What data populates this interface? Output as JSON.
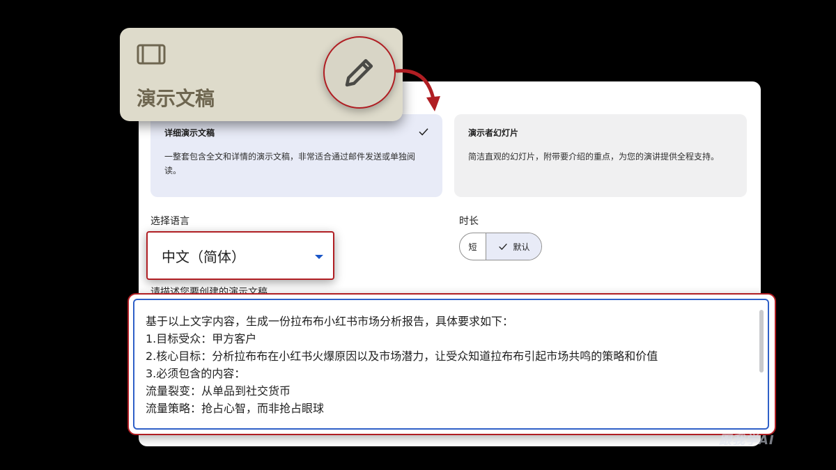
{
  "tile": {
    "icon": "slides-icon",
    "title": "演示文稿",
    "edit_icon": "pencil-icon"
  },
  "cards": [
    {
      "title": "详细演示文稿",
      "description": "一整套包含全文和详情的演示文稿，非常适合通过邮件发送或单独阅读。",
      "selected": true
    },
    {
      "title": "演示者幻灯片",
      "description": "简洁直观的幻灯片，附带要介绍的重点，为您的演讲提供全程支持。",
      "selected": false
    }
  ],
  "language": {
    "label": "选择语言",
    "value": "中文（简体）"
  },
  "duration": {
    "label": "时长",
    "options": [
      "短",
      "默认"
    ],
    "selected": "默认"
  },
  "prompt": {
    "label": "请描述您要创建的演示文稿",
    "lines": [
      "基于以上文字内容，生成一份拉布布小红书市场分析报告，具体要求如下：",
      "1.目标受众：甲方客户",
      "2.核心目标：分析拉布布在小红书火爆原因以及市场潜力，让受众知道拉布布引起市场共鸣的策略和价值",
      "3.必须包含的内容：",
      "流量裂变：从单品到社交货币",
      "流量策略：抢占心智，而非抢占眼球"
    ]
  },
  "watermark": "跟我学AI",
  "colors": {
    "highlight": "#b01e23",
    "selected_bg": "#e8ebf7",
    "focus_border": "#2f60c8",
    "tile_bg": "#dedbcb"
  }
}
